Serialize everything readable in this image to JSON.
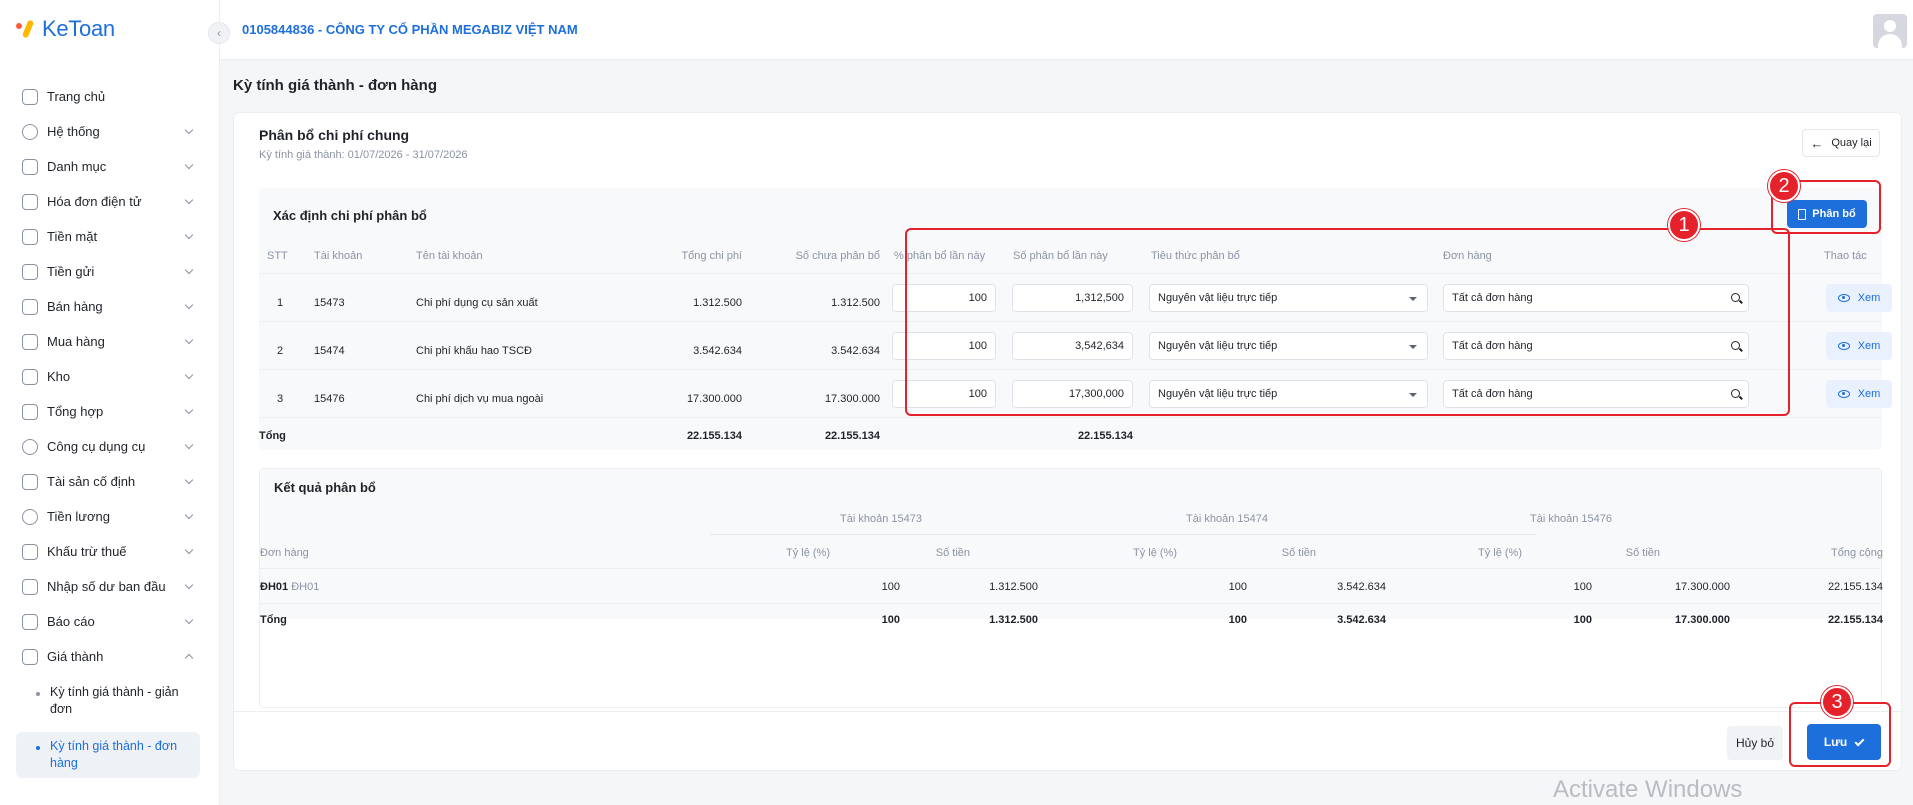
{
  "sidebar": {
    "logo": "KeToan",
    "items": [
      {
        "label": "Trang chủ"
      },
      {
        "label": "Hệ thống"
      },
      {
        "label": "Danh mục"
      },
      {
        "label": "Hóa đơn điện tử"
      },
      {
        "label": "Tiền mặt"
      },
      {
        "label": "Tiền gửi"
      },
      {
        "label": "Bán hàng"
      },
      {
        "label": "Mua hàng"
      },
      {
        "label": "Kho"
      },
      {
        "label": "Tổng hợp"
      },
      {
        "label": "Công cụ dụng cụ"
      },
      {
        "label": "Tài sản cố định"
      },
      {
        "label": "Tiền lương"
      },
      {
        "label": "Khấu trừ thuế"
      },
      {
        "label": "Nhập số dư ban đầu"
      },
      {
        "label": "Báo cáo"
      },
      {
        "label": "Giá thành"
      }
    ],
    "subitems": [
      {
        "label": "Kỳ tính giá thành - giản đơn"
      },
      {
        "label": "Kỳ tính giá thành - đơn hàng"
      }
    ]
  },
  "header": {
    "company": "0105844836 - CÔNG TY CỔ PHẦN MEGABIZ VIỆT NAM"
  },
  "page": {
    "title": "Kỳ tính giá thành - đơn hàng",
    "card_title": "Phân bổ chi phí chung",
    "card_subtitle": "Kỳ tính giá thành: 01/07/2026 - 31/07/2026",
    "back_label": "Quay lại",
    "allocate_label": "Phân bổ",
    "cancel_label": "Hủy bỏ",
    "save_label": "Lưu"
  },
  "allocation": {
    "title": "Xác định chi phí phân bổ",
    "columns": [
      "STT",
      "Tài khoản",
      "Tên tài khoản",
      "Tổng chi phí",
      "Số chưa phân bổ",
      "% phân bổ lần này",
      "Số phân bổ lần này",
      "Tiêu thức phân bổ",
      "Đơn hàng",
      "Thao tác"
    ],
    "rows": [
      {
        "stt": "1",
        "account": "15473",
        "name": "Chi phí dụng cụ sản xuất",
        "total": "1.312.500",
        "unallocated": "1.312.500",
        "percent": "100",
        "amount": "1,312,500",
        "criteria": "Nguyên vật liệu trực tiếp",
        "order": "Tất cả đơn hàng",
        "action": "Xem"
      },
      {
        "stt": "2",
        "account": "15474",
        "name": "Chi phí khấu hao TSCĐ",
        "total": "3.542.634",
        "unallocated": "3.542.634",
        "percent": "100",
        "amount": "3,542,634",
        "criteria": "Nguyên vật liệu trực tiếp",
        "order": "Tất cả đơn hàng",
        "action": "Xem"
      },
      {
        "stt": "3",
        "account": "15476",
        "name": "Chi phí dịch vụ mua ngoài",
        "total": "17.300.000",
        "unallocated": "17.300.000",
        "percent": "100",
        "amount": "17,300,000",
        "criteria": "Nguyên vật liệu trực tiếp",
        "order": "Tất cả đơn hàng",
        "action": "Xem"
      }
    ],
    "total": {
      "label": "Tổng",
      "total": "22.155.134",
      "unallocated": "22.155.134",
      "amount": "22.155.134"
    }
  },
  "result": {
    "title": "Kết quả phân bổ",
    "groups": [
      "Tài khoản 15473",
      "Tài khoản 15474",
      "Tài khoản 15476"
    ],
    "col_order": "Đơn hàng",
    "col_rate": "Tỷ lệ (%)",
    "col_amount": "Số tiền",
    "col_grand": "Tổng cộng",
    "row": {
      "order": "ĐH01",
      "order_sub": "ĐH01",
      "r1": "100",
      "a1": "1.312.500",
      "r2": "100",
      "a2": "3.542.634",
      "r3": "100",
      "a3": "17.300.000",
      "grand": "22.155.134"
    },
    "total": {
      "label": "Tổng",
      "r1": "100",
      "a1": "1.312.500",
      "r2": "100",
      "a2": "3.542.634",
      "r3": "100",
      "a3": "17.300.000",
      "grand": "22.155.134"
    }
  },
  "annotations": [
    "1",
    "2",
    "3"
  ],
  "watermark": "Activate Windows",
  "colors": {
    "accent": "#1d6fdc",
    "annotation": "#e5212b"
  }
}
